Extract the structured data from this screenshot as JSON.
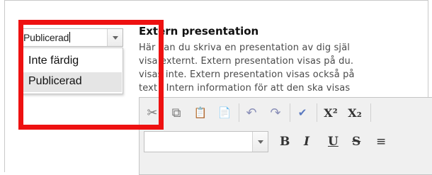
{
  "status_select": {
    "value": "Publicerad",
    "options": [
      "Inte färdig",
      "Publicerad"
    ],
    "selected_option": "Publicerad"
  },
  "section": {
    "title": "Extern presentation",
    "description_lines": [
      "Här kan du skriva en presentation av dig själ",
      "visa externt. Extern presentation visas på du.",
      "visas inte. Extern presentation visas också på",
      "text i Intern information för att den ska visas"
    ]
  },
  "editor": {
    "toolbar_row1": [
      "cut-icon",
      "copy-icon",
      "paste-icon",
      "paste-word-icon",
      "undo-icon",
      "redo-icon",
      "spellcheck-icon",
      "superscript-icon",
      "subscript-icon"
    ],
    "superscript_label": "X²",
    "subscript_label": "X₂",
    "bold_label": "B",
    "italic_label": "I",
    "underline_label": "U",
    "strike_label": "S",
    "align_label": "≡",
    "cut_glyph": "✂",
    "copy_glyph": "⧉",
    "paste_glyph": "📋",
    "paste_word_glyph": "📄",
    "undo_glyph": "↶",
    "redo_glyph": "↷",
    "spell_glyph": "✔"
  },
  "colors": {
    "highlight": "#ee1111",
    "selected_option_bg": "#e5e5e5"
  }
}
